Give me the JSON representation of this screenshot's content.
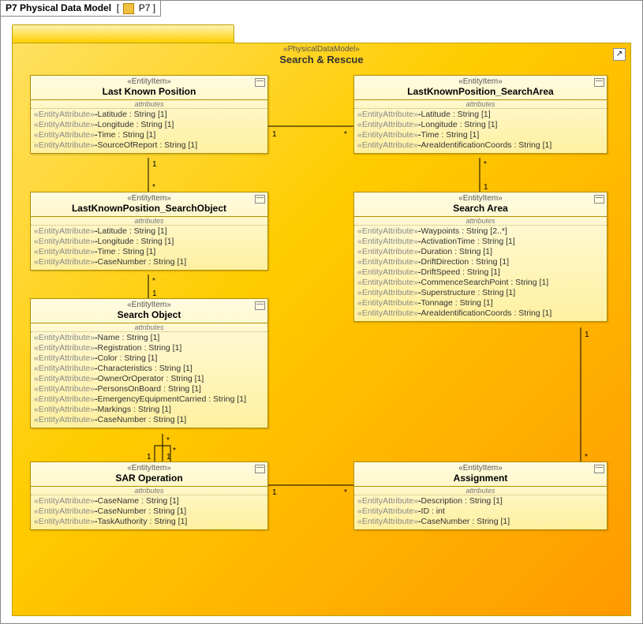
{
  "frame": {
    "title": "P7 Physical Data Model",
    "tabIconText": "P7"
  },
  "package": {
    "stereotype": "«PhysicalDataModel»",
    "name": "Search & Rescue"
  },
  "entities": {
    "lkp": {
      "stereotype": "«EntityItem»",
      "name": "Last Known Position",
      "attrsLabel": "attributes",
      "attrs": [
        {
          "stereo": "«EntityAttribute»",
          "vis": "-",
          "name": "Latitude",
          "type": "String",
          "mult": "[1]"
        },
        {
          "stereo": "«EntityAttribute»",
          "vis": "-",
          "name": "Longitude",
          "type": "String",
          "mult": "[1]"
        },
        {
          "stereo": "«EntityAttribute»",
          "vis": "-",
          "name": "Time",
          "type": "String",
          "mult": "[1]"
        },
        {
          "stereo": "«EntityAttribute»",
          "vis": "-",
          "name": "SourceOfReport",
          "type": "String",
          "mult": "[1]"
        }
      ]
    },
    "lkp_sa": {
      "stereotype": "«EntityItem»",
      "name": "LastKnownPosition_SearchArea",
      "attrsLabel": "attributes",
      "attrs": [
        {
          "stereo": "«EntityAttribute»",
          "vis": "-",
          "name": "Latitude",
          "type": "String",
          "mult": "[1]"
        },
        {
          "stereo": "«EntityAttribute»",
          "vis": "-",
          "name": "Longitude",
          "type": "String",
          "mult": "[1]"
        },
        {
          "stereo": "«EntityAttribute»",
          "vis": "-",
          "name": "Time",
          "type": "String",
          "mult": "[1]"
        },
        {
          "stereo": "«EntityAttribute»",
          "vis": "-",
          "name": "AreaIdentificationCoords",
          "type": "String",
          "mult": "[1]"
        }
      ]
    },
    "lkp_so": {
      "stereotype": "«EntityItem»",
      "name": "LastKnownPosition_SearchObject",
      "attrsLabel": "attributes",
      "attrs": [
        {
          "stereo": "«EntityAttribute»",
          "vis": "-",
          "name": "Latitude",
          "type": "String",
          "mult": "[1]"
        },
        {
          "stereo": "«EntityAttribute»",
          "vis": "-",
          "name": "Longitude",
          "type": "String",
          "mult": "[1]"
        },
        {
          "stereo": "«EntityAttribute»",
          "vis": "-",
          "name": "Time",
          "type": "String",
          "mult": "[1]"
        },
        {
          "stereo": "«EntityAttribute»",
          "vis": "-",
          "name": "CaseNumber",
          "type": "String",
          "mult": "[1]"
        }
      ]
    },
    "sa": {
      "stereotype": "«EntityItem»",
      "name": "Search Area",
      "attrsLabel": "attributes",
      "attrs": [
        {
          "stereo": "«EntityAttribute»",
          "vis": "-",
          "name": "Waypoints",
          "type": "String",
          "mult": "[2..*]"
        },
        {
          "stereo": "«EntityAttribute»",
          "vis": "-",
          "name": "ActivationTime",
          "type": "String",
          "mult": "[1]"
        },
        {
          "stereo": "«EntityAttribute»",
          "vis": "-",
          "name": "Duration",
          "type": "String",
          "mult": "[1]"
        },
        {
          "stereo": "«EntityAttribute»",
          "vis": "-",
          "name": "DriftDirection",
          "type": "String",
          "mult": "[1]"
        },
        {
          "stereo": "«EntityAttribute»",
          "vis": "-",
          "name": "DriftSpeed",
          "type": "String",
          "mult": "[1]"
        },
        {
          "stereo": "«EntityAttribute»",
          "vis": "-",
          "name": "CommenceSearchPoint",
          "type": "String",
          "mult": "[1]"
        },
        {
          "stereo": "«EntityAttribute»",
          "vis": "-",
          "name": "Superstructure",
          "type": "String",
          "mult": "[1]"
        },
        {
          "stereo": "«EntityAttribute»",
          "vis": "-",
          "name": "Tonnage",
          "type": "String",
          "mult": "[1]"
        },
        {
          "stereo": "«EntityAttribute»",
          "vis": "-",
          "name": "AreaIdentificationCoords",
          "type": "String",
          "mult": "[1]"
        }
      ]
    },
    "so": {
      "stereotype": "«EntityItem»",
      "name": "Search Object",
      "attrsLabel": "attributes",
      "attrs": [
        {
          "stereo": "«EntityAttribute»",
          "vis": "-",
          "name": "Name",
          "type": "String",
          "mult": "[1]"
        },
        {
          "stereo": "«EntityAttribute»",
          "vis": "-",
          "name": "Registration",
          "type": "String",
          "mult": "[1]"
        },
        {
          "stereo": "«EntityAttribute»",
          "vis": "-",
          "name": "Color",
          "type": "String",
          "mult": "[1]"
        },
        {
          "stereo": "«EntityAttribute»",
          "vis": "-",
          "name": "Characteristics",
          "type": "String",
          "mult": "[1]"
        },
        {
          "stereo": "«EntityAttribute»",
          "vis": "-",
          "name": "OwnerOrOperator",
          "type": "String",
          "mult": "[1]"
        },
        {
          "stereo": "«EntityAttribute»",
          "vis": "-",
          "name": "PersonsOnBoard",
          "type": "String",
          "mult": "[1]"
        },
        {
          "stereo": "«EntityAttribute»",
          "vis": "-",
          "name": "EmergencyEquipmentCarried",
          "type": "String",
          "mult": "[1]"
        },
        {
          "stereo": "«EntityAttribute»",
          "vis": "-",
          "name": "Markings",
          "type": "String",
          "mult": "[1]"
        },
        {
          "stereo": "«EntityAttribute»",
          "vis": "-",
          "name": "CaseNumber",
          "type": "String",
          "mult": "[1]"
        }
      ]
    },
    "sar": {
      "stereotype": "«EntityItem»",
      "name": "SAR Operation",
      "attrsLabel": "attributes",
      "attrs": [
        {
          "stereo": "«EntityAttribute»",
          "vis": "-",
          "name": "CaseName",
          "type": "String",
          "mult": "[1]"
        },
        {
          "stereo": "«EntityAttribute»",
          "vis": "-",
          "name": "CaseNumber",
          "type": "String",
          "mult": "[1]"
        },
        {
          "stereo": "«EntityAttribute»",
          "vis": "-",
          "name": "TaskAuthority",
          "type": "String",
          "mult": "[1]"
        }
      ]
    },
    "assign": {
      "stereotype": "«EntityItem»",
      "name": "Assignment",
      "attrsLabel": "attributes",
      "attrs": [
        {
          "stereo": "«EntityAttribute»",
          "vis": "-",
          "name": "Description",
          "type": "String",
          "mult": "[1]"
        },
        {
          "stereo": "«EntityAttribute»",
          "vis": "-",
          "name": "ID",
          "type": "int",
          "mult": ""
        },
        {
          "stereo": "«EntityAttribute»",
          "vis": "-",
          "name": "CaseNumber",
          "type": "String",
          "mult": "[1]"
        }
      ]
    }
  },
  "multiplicities": {
    "one": "1",
    "star": "*"
  }
}
